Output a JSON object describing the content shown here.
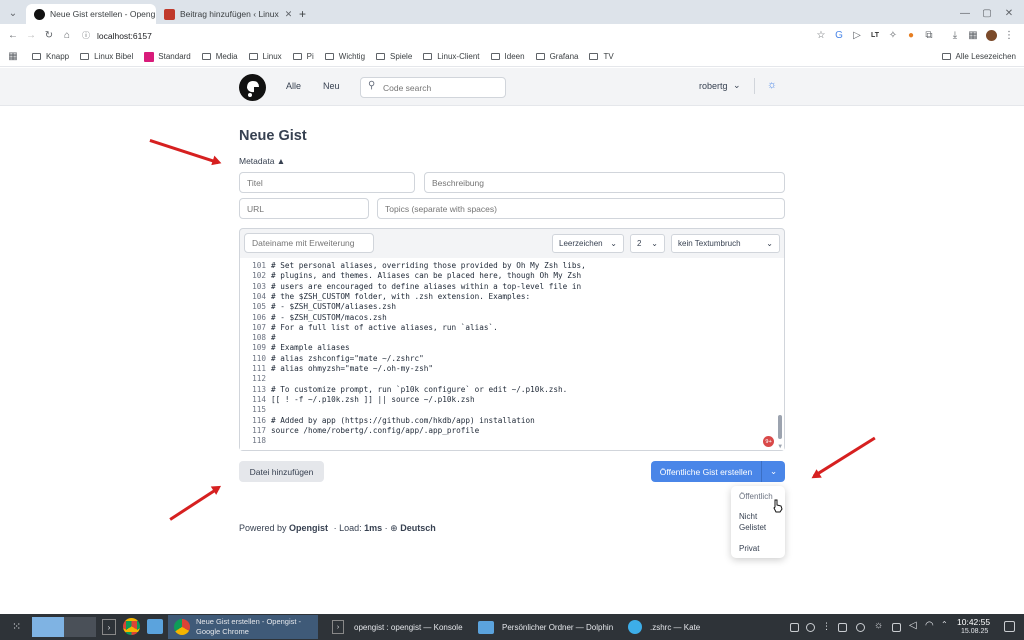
{
  "browser": {
    "tabs": [
      {
        "title": "Neue Gist erstellen - Openg",
        "active": true
      },
      {
        "title": "Beitrag hinzufügen ‹ Linux",
        "active": false
      }
    ],
    "new_tab": "+",
    "url": "localhost:6157",
    "bookmarks": [
      "Knapp",
      "Linux Bibel",
      "Standard",
      "Media",
      "Linux",
      "Pi",
      "Wichtig",
      "Spiele",
      "Linux-Client",
      "Ideen",
      "Grafana",
      "TV"
    ],
    "all_bookmarks": "Alle Lesezeichen"
  },
  "nav": {
    "links": [
      "Alle",
      "Neu"
    ],
    "search_placeholder": "Code search",
    "user": "robertg"
  },
  "form": {
    "heading": "Neue Gist",
    "metadata_toggle": "Metadata ▲",
    "title_placeholder": "Titel",
    "description_placeholder": "Beschreibung",
    "url_placeholder": "URL",
    "topics_placeholder": "Topics (separate with spaces)",
    "filename_placeholder": "Dateiname mit Erweiterung",
    "indent_type": "Leerzeichen",
    "indent_size": "2",
    "wrap": "kein Textumbruch",
    "badge": "9+"
  },
  "code_lines": [
    {
      "n": "101",
      "t": "# Set personal aliases, overriding those provided by Oh My Zsh libs,"
    },
    {
      "n": "102",
      "t": "# plugins, and themes. Aliases can be placed here, though Oh My Zsh"
    },
    {
      "n": "103",
      "t": "# users are encouraged to define aliases within a top-level file in"
    },
    {
      "n": "104",
      "t": "# the $ZSH_CUSTOM folder, with .zsh extension. Examples:"
    },
    {
      "n": "105",
      "t": "# - $ZSH_CUSTOM/aliases.zsh"
    },
    {
      "n": "106",
      "t": "# - $ZSH_CUSTOM/macos.zsh"
    },
    {
      "n": "107",
      "t": "# For a full list of active aliases, run `alias`."
    },
    {
      "n": "108",
      "t": "#"
    },
    {
      "n": "109",
      "t": "# Example aliases"
    },
    {
      "n": "110",
      "t": "# alias zshconfig=\"mate ~/.zshrc\""
    },
    {
      "n": "111",
      "t": "# alias ohmyzsh=\"mate ~/.oh-my-zsh\""
    },
    {
      "n": "112",
      "t": ""
    },
    {
      "n": "113",
      "t": "# To customize prompt, run `p10k configure` or edit ~/.p10k.zsh."
    },
    {
      "n": "114",
      "t": "[[ ! -f ~/.p10k.zsh ]] || source ~/.p10k.zsh"
    },
    {
      "n": "115",
      "t": ""
    },
    {
      "n": "116",
      "t": "# Added by app (https://github.com/hkdb/app) installation"
    },
    {
      "n": "117",
      "t": "source /home/robertg/.config/app/.app_profile"
    },
    {
      "n": "118",
      "t": ""
    }
  ],
  "actions": {
    "add_file": "Datei hinzufügen",
    "create": "Öffentliche Gist erstellen",
    "visibility_options": [
      "Öffentlich",
      "Nicht Gelistet",
      "Privat"
    ]
  },
  "footer": {
    "powered_by": "Powered by",
    "brand": "Opengist",
    "load_label": "· Load:",
    "load_value": "1ms",
    "language": "Deutsch"
  },
  "taskbar": {
    "tasks": [
      "Neue Gist erstellen - Opengist - Google Chrome",
      "opengist : opengist — Konsole",
      "Persönlicher Ordner — Dolphin",
      ".zshrc — Kate"
    ],
    "time": "10:42:55",
    "date": "15.08.25"
  },
  "colors": {
    "primary": "#4a86e8",
    "arrow": "#d62020",
    "taskbar": "#2e3338"
  }
}
